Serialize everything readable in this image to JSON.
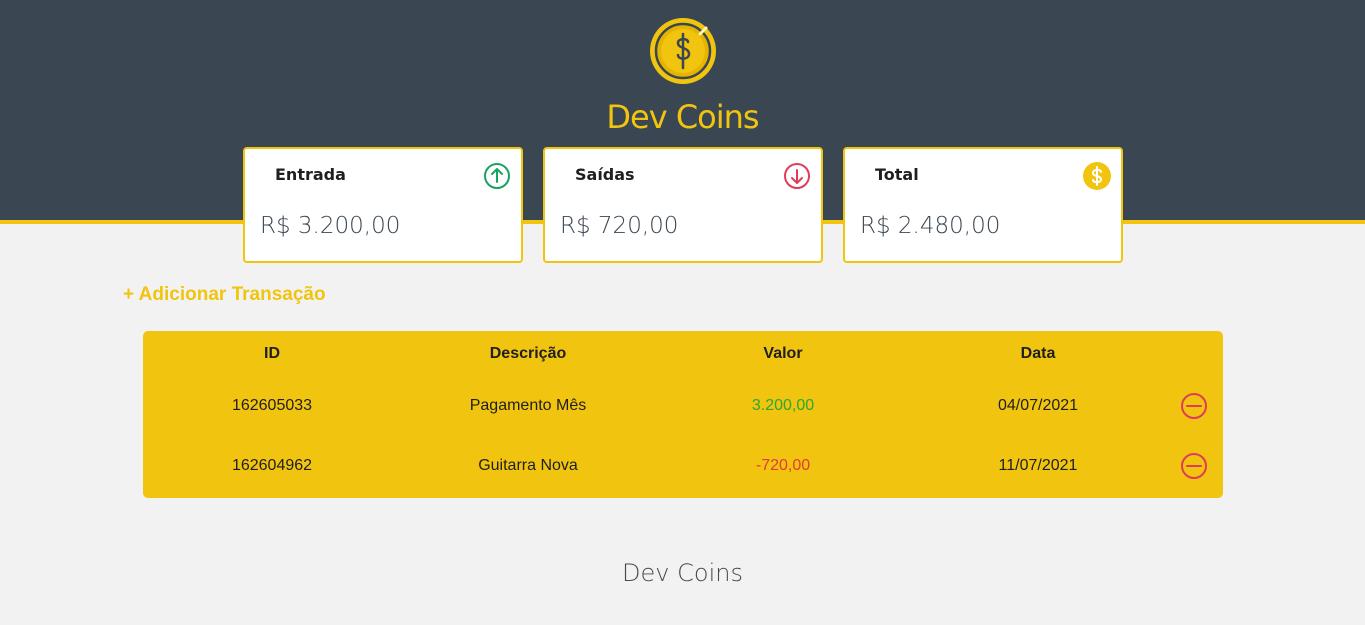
{
  "app": {
    "brand": "Dev Coins",
    "logo_icon": "dollar-coin-icon",
    "accent_color": "#f1c40f",
    "header_color": "#3a4651"
  },
  "summary": {
    "entrada": {
      "label": "Entrada",
      "value": "R$ 3.200,00",
      "icon": "arrow-up-circle-icon",
      "color": "#1aa260"
    },
    "saidas": {
      "label": "Saídas",
      "value": "R$ 720,00",
      "icon": "arrow-down-circle-icon",
      "color": "#e23b5a"
    },
    "total": {
      "label": "Total",
      "value": "R$ 2.480,00",
      "icon": "dollar-circle-icon",
      "color": "#f1c40f"
    }
  },
  "actions": {
    "add_transaction": "+ Adicionar Transação"
  },
  "table": {
    "headers": {
      "id": "ID",
      "description": "Descrição",
      "value": "Valor",
      "date": "Data"
    },
    "rows": [
      {
        "id": "162605033",
        "description": "Pagamento Mês",
        "value": "3.200,00",
        "date": "04/07/2021",
        "type": "positive",
        "remove_icon": "minus-circle-icon"
      },
      {
        "id": "162604962",
        "description": "Guitarra Nova",
        "value": "-720,00",
        "date": "11/07/2021",
        "type": "negative",
        "remove_icon": "minus-circle-icon"
      }
    ]
  },
  "footer": {
    "text": "Dev Coins"
  }
}
